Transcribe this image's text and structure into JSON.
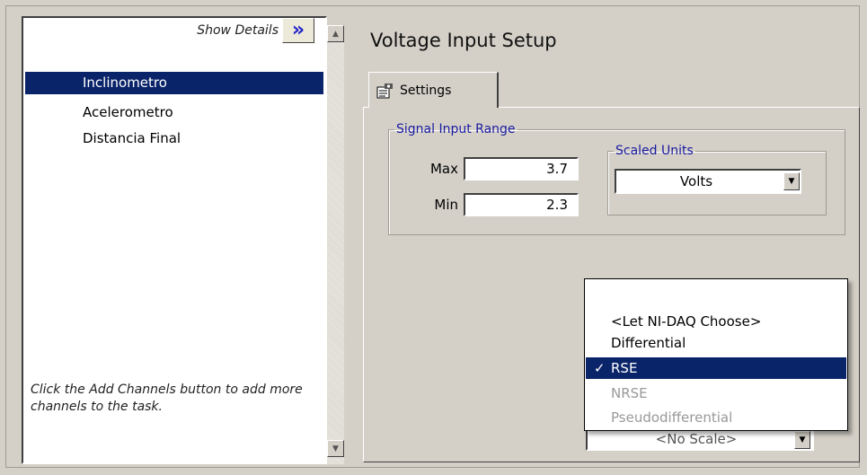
{
  "channel_list": {
    "show_details_label": "Show Details",
    "show_details_icon": "double-chevron-right-icon",
    "items": [
      {
        "label": "Inclinometro",
        "selected": true
      },
      {
        "label": "Acelerometro",
        "selected": false
      },
      {
        "label": "Distancia Final",
        "selected": false
      }
    ],
    "hint": "Click the Add Channels button to add more channels to the task."
  },
  "setup": {
    "title": "Voltage Input Setup",
    "tab_label": "Settings",
    "signal_range": {
      "legend": "Signal Input Range",
      "max_label": "Max",
      "max_value": "3.7",
      "min_label": "Min",
      "min_value": "2.3"
    },
    "scaled_units": {
      "legend": "Scaled Units",
      "value": "Volts"
    }
  },
  "terminal_config_dropdown": {
    "options": [
      {
        "label": "<Let NI-DAQ Choose>",
        "state": "normal"
      },
      {
        "label": "Differential",
        "state": "normal"
      },
      {
        "label": "RSE",
        "state": "selected"
      },
      {
        "label": "NRSE",
        "state": "disabled"
      },
      {
        "label": "Pseudodifferential",
        "state": "disabled"
      }
    ],
    "check_mark": "✓"
  },
  "custom_scaling_partial": "<No Scale>",
  "colors": {
    "selection": "#0a246a",
    "legend_text": "#1a1aa0",
    "chevron": "#2222cc",
    "background": "#d4d0c8"
  }
}
